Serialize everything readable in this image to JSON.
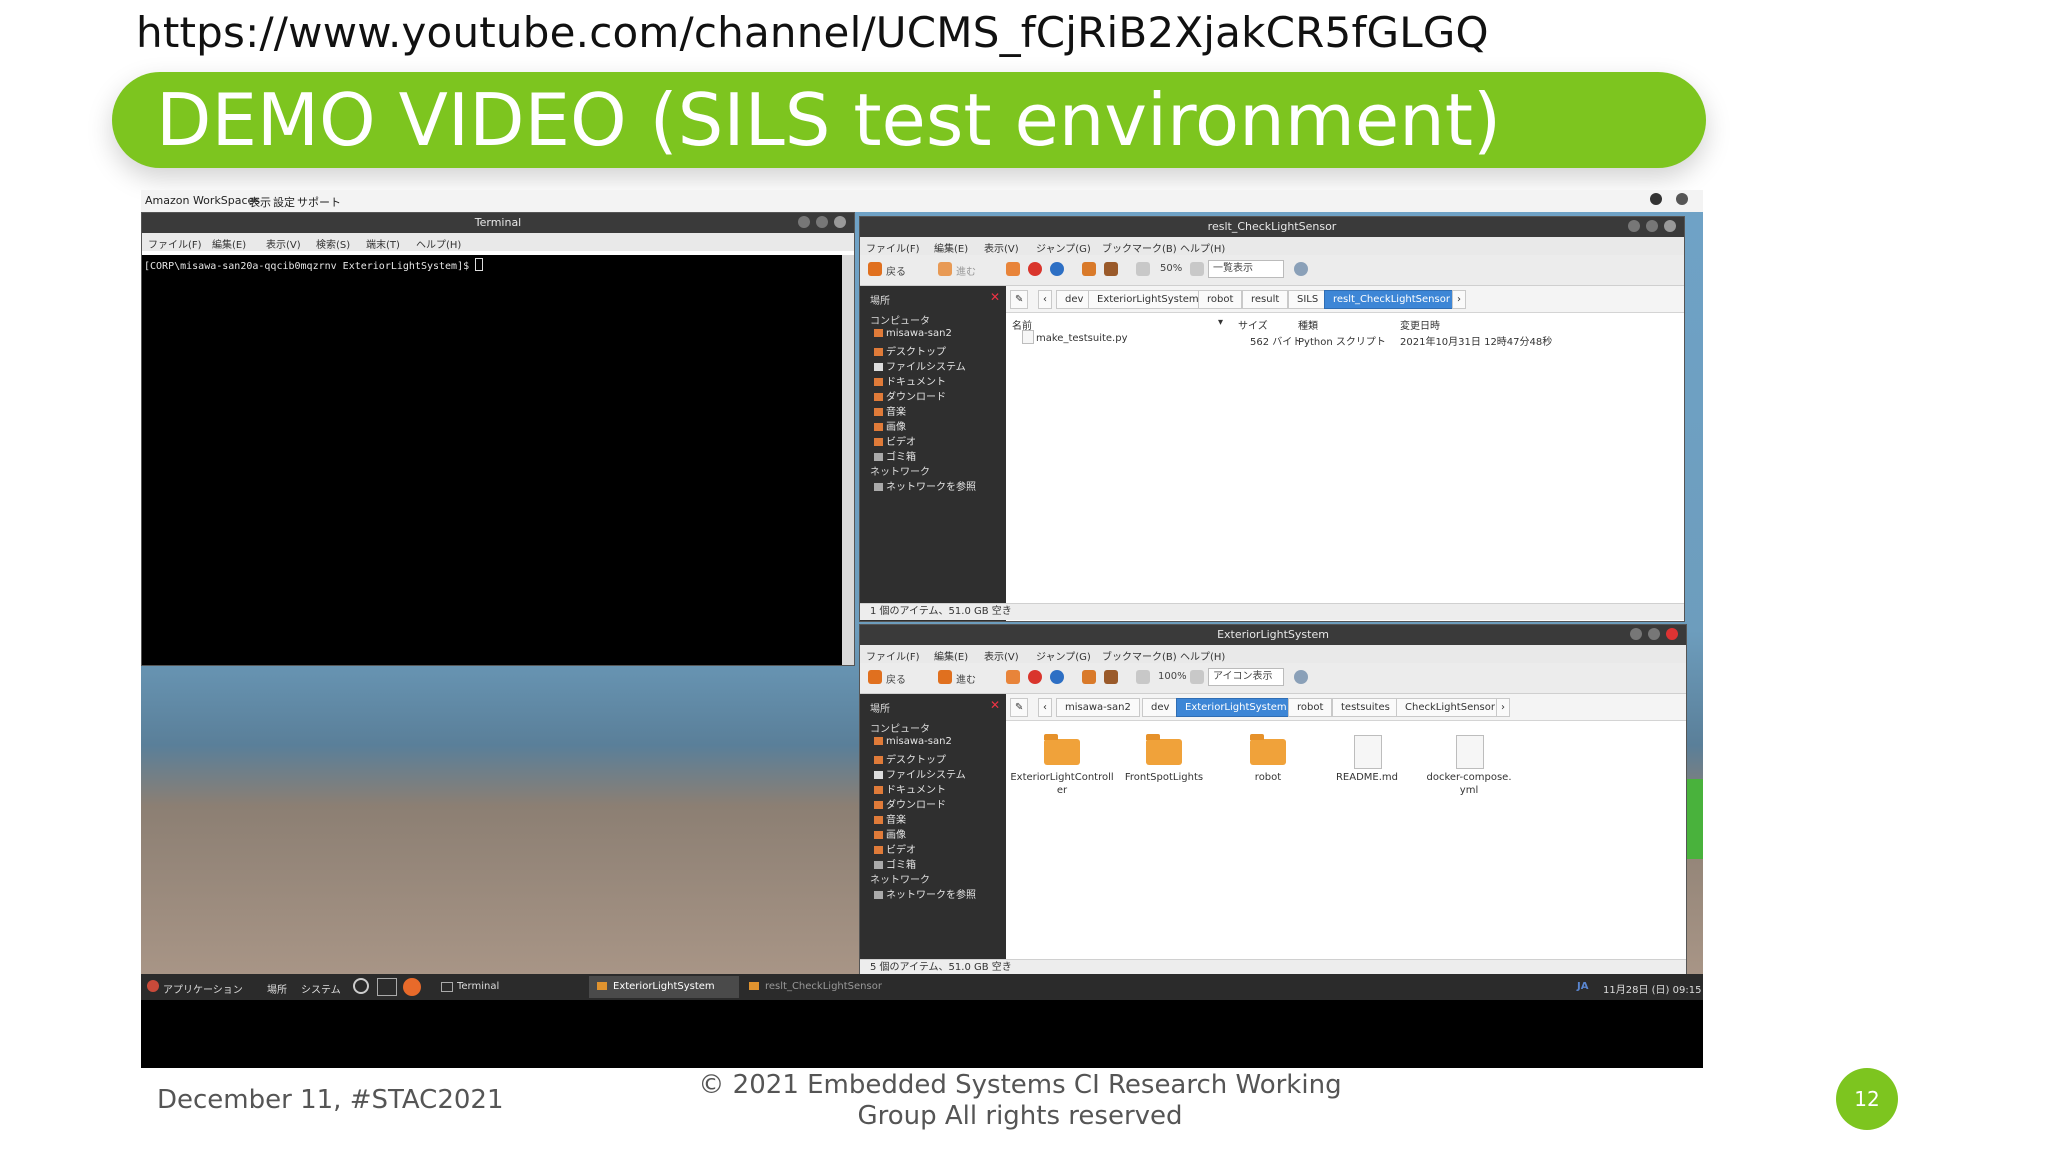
{
  "url_text": "https://www.youtube.com/channel/UCMS_fCjRiB2XjakCR5fGLGQ",
  "banner": {
    "title": "DEMO VIDEO (SILS test environment)",
    "color": "#7dc51f"
  },
  "workspace_bar": {
    "app": "Amazon WorkSpaces",
    "menu1": "表示",
    "menu2": "設定",
    "menu3": "サポート"
  },
  "terminal": {
    "title": "Terminal",
    "menus": [
      "ファイル(F)",
      "編集(E)",
      "表示(V)",
      "検索(S)",
      "端末(T)",
      "ヘルプ(H)"
    ],
    "prompt": "[CORP\\misawa-san20a-qqcib0mqzrnv ExteriorLightSystem]$ "
  },
  "fm1": {
    "title": "reslt_CheckLightSensor",
    "menus": [
      "ファイル(F)",
      "編集(E)",
      "表示(V)",
      "ジャンプ(G)",
      "ブックマーク(B)",
      "ヘルプ(H)"
    ],
    "back": "戻る",
    "forward": "進む",
    "zoom": "50%",
    "view": "一覧表示",
    "sidebar_header": "場所",
    "sidebar": [
      "コンピュータ",
      "misawa-san2",
      "デスクトップ",
      "ファイルシステム",
      "ドキュメント",
      "ダウンロード",
      "音楽",
      "画像",
      "ビデオ",
      "ゴミ箱",
      "ネットワーク",
      "ネットワークを参照"
    ],
    "crumbs": [
      "dev",
      "ExteriorLightSystem",
      "robot",
      "result",
      "SILS",
      "reslt_CheckLightSensor"
    ],
    "columns": [
      "名前",
      "サイズ",
      "種類",
      "変更日時"
    ],
    "file": {
      "name": "make_testsuite.py",
      "size": "562 バイト",
      "type": "Python スクリプト",
      "date": "2021年10月31日 12時47分48秒"
    },
    "status": "1 個のアイテム、51.0 GB 空き"
  },
  "fm2": {
    "title": "ExteriorLightSystem",
    "menus": [
      "ファイル(F)",
      "編集(E)",
      "表示(V)",
      "ジャンプ(G)",
      "ブックマーク(B)",
      "ヘルプ(H)"
    ],
    "back": "戻る",
    "forward": "進む",
    "zoom": "100%",
    "view": "アイコン表示",
    "sidebar_header": "場所",
    "sidebar": [
      "コンピュータ",
      "misawa-san2",
      "デスクトップ",
      "ファイルシステム",
      "ドキュメント",
      "ダウンロード",
      "音楽",
      "画像",
      "ビデオ",
      "ゴミ箱",
      "ネットワーク",
      "ネットワークを参照"
    ],
    "crumbs": [
      "misawa-san2",
      "dev",
      "ExteriorLightSystem",
      "robot",
      "testsuites",
      "CheckLightSensor"
    ],
    "items": [
      {
        "label1": "ExteriorLightControll",
        "label2": "er",
        "kind": "folder"
      },
      {
        "label1": "FrontSpotLights",
        "label2": "",
        "kind": "folder"
      },
      {
        "label1": "robot",
        "label2": "",
        "kind": "folder"
      },
      {
        "label1": "README.md",
        "label2": "",
        "kind": "file"
      },
      {
        "label1": "docker-compose.",
        "label2": "yml",
        "kind": "file"
      }
    ],
    "status": "5 個のアイテム、51.0 GB 空き"
  },
  "taskbar": {
    "apps": "アプリケーション",
    "places": "場所",
    "system": "システム",
    "task1": "Terminal",
    "task2": "ExteriorLightSystem",
    "task3": "reslt_CheckLightSensor",
    "lang": "JA",
    "clock": "11月28日 (日) 09:15"
  },
  "footer": {
    "left": "December 11, #STAC2021",
    "copyright_line1": "©  2021 Embedded Systems CI Research Working",
    "copyright_line2": "Group All rights reserved",
    "page": "12"
  }
}
